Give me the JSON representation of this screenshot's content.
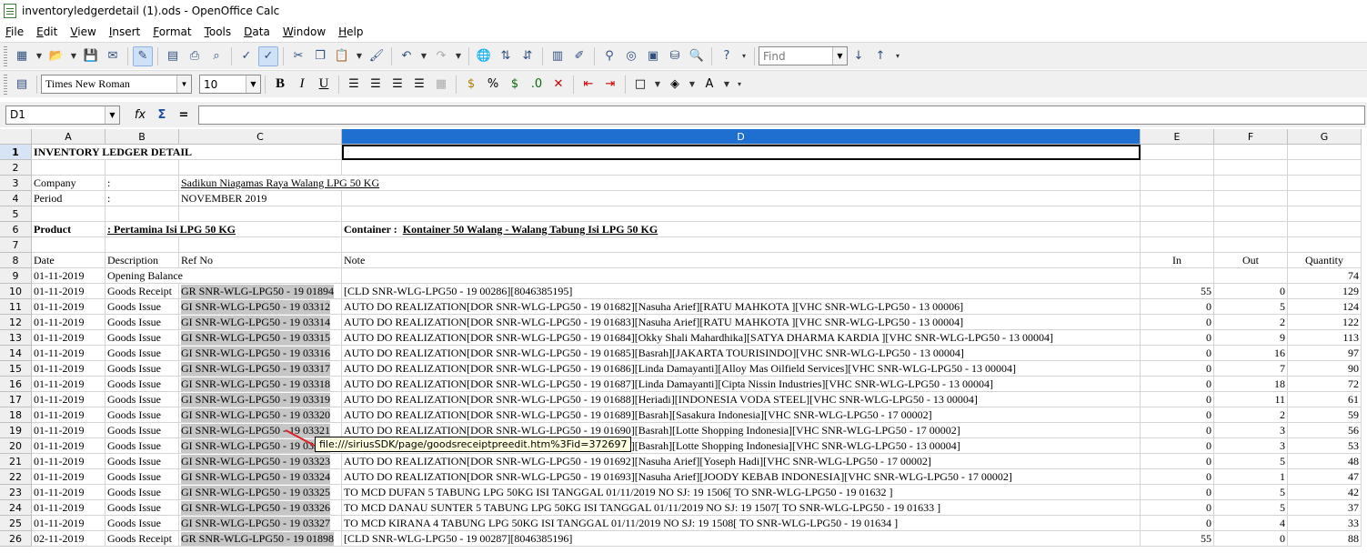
{
  "window": {
    "title": "inventoryledgerdetail (1).ods - OpenOffice Calc"
  },
  "menu": [
    "File",
    "Edit",
    "View",
    "Insert",
    "Format",
    "Tools",
    "Data",
    "Window",
    "Help"
  ],
  "toolbar": {
    "find_placeholder": "Find"
  },
  "format": {
    "font_name": "Times New Roman",
    "font_size": "10"
  },
  "formula": {
    "cell_ref": "D1",
    "func_icon": "fx",
    "sum_icon": "Σ",
    "equal_icon": "=",
    "content": ""
  },
  "columns": [
    "A",
    "B",
    "C",
    "D",
    "E",
    "F",
    "G"
  ],
  "tooltip": "file:///siriusSDK/page/goodsreceiptpreedit.htm%3Fid=372697",
  "sheet": {
    "title": "INVENTORY LEDGER DETAIL",
    "company_label": "Company",
    "company_colon": ":",
    "company_value": "Sadikun Niagamas Raya Walang LPG 50 KG",
    "period_label": "Period",
    "period_colon": ":",
    "period_value": "NOVEMBER 2019",
    "product_label": "Product",
    "product_value": ":  Pertamina Isi LPG 50 KG",
    "container_label": "Container :  ",
    "container_value": "Kontainer 50 Walang - Walang Tabung Isi LPG 50 KG",
    "headers": {
      "date": "Date",
      "description": "Description",
      "ref": "Ref No",
      "note": "Note",
      "in": "In",
      "out": "Out",
      "qty": "Quantity"
    },
    "opening": {
      "date": "01-11-2019",
      "description": "Opening Balance",
      "qty": "74"
    },
    "rows": [
      {
        "row": "10",
        "date": "01-11-2019",
        "desc": "Goods Receipt",
        "ref": "GR SNR-WLG-LPG50 - 19 01894",
        "note": "[CLD SNR-WLG-LPG50 - 19 00286][8046385195]",
        "in": "55",
        "out": "0",
        "qty": "129"
      },
      {
        "row": "11",
        "date": "01-11-2019",
        "desc": "Goods Issue",
        "ref": "GI SNR-WLG-LPG50 - 19 03312",
        "note": "AUTO DO REALIZATION[DOR SNR-WLG-LPG50 - 19 01682][Nasuha Arief][RATU MAHKOTA ][VHC SNR-WLG-LPG50 - 13 00006]",
        "in": "0",
        "out": "5",
        "qty": "124"
      },
      {
        "row": "12",
        "date": "01-11-2019",
        "desc": "Goods Issue",
        "ref": "GI SNR-WLG-LPG50 - 19 03314",
        "note": "AUTO DO REALIZATION[DOR SNR-WLG-LPG50 - 19 01683][Nasuha Arief][RATU MAHKOTA ][VHC SNR-WLG-LPG50 - 13 00004]",
        "in": "0",
        "out": "2",
        "qty": "122"
      },
      {
        "row": "13",
        "date": "01-11-2019",
        "desc": "Goods Issue",
        "ref": "GI SNR-WLG-LPG50 - 19 03315",
        "note": "AUTO DO REALIZATION[DOR SNR-WLG-LPG50 - 19 01684][Okky Shali Mahardhika][SATYA DHARMA KARDIA ][VHC SNR-WLG-LPG50 - 13 00004]",
        "in": "0",
        "out": "9",
        "qty": "113"
      },
      {
        "row": "14",
        "date": "01-11-2019",
        "desc": "Goods Issue",
        "ref": "GI SNR-WLG-LPG50 - 19 03316",
        "note": "AUTO DO REALIZATION[DOR SNR-WLG-LPG50 - 19 01685][Basrah][JAKARTA TOURISINDO][VHC SNR-WLG-LPG50 - 13 00004]",
        "in": "0",
        "out": "16",
        "qty": "97"
      },
      {
        "row": "15",
        "date": "01-11-2019",
        "desc": "Goods Issue",
        "ref": "GI SNR-WLG-LPG50 - 19 03317",
        "note": "AUTO DO REALIZATION[DOR SNR-WLG-LPG50 - 19 01686][Linda Damayanti][Alloy Mas Oilfield Services][VHC SNR-WLG-LPG50 - 13 00004]",
        "in": "0",
        "out": "7",
        "qty": "90"
      },
      {
        "row": "16",
        "date": "01-11-2019",
        "desc": "Goods Issue",
        "ref": "GI SNR-WLG-LPG50 - 19 03318",
        "note": "AUTO DO REALIZATION[DOR SNR-WLG-LPG50 - 19 01687][Linda Damayanti][Cipta Nissin Industries][VHC SNR-WLG-LPG50 - 13 00004]",
        "in": "0",
        "out": "18",
        "qty": "72"
      },
      {
        "row": "17",
        "date": "01-11-2019",
        "desc": "Goods Issue",
        "ref": "GI SNR-WLG-LPG50 - 19 03319",
        "note": "AUTO DO REALIZATION[DOR SNR-WLG-LPG50 - 19 01688][Heriadi][INDONESIA VODA STEEL][VHC SNR-WLG-LPG50 - 13 00004]",
        "in": "0",
        "out": "11",
        "qty": "61"
      },
      {
        "row": "18",
        "date": "01-11-2019",
        "desc": "Goods Issue",
        "ref": "GI SNR-WLG-LPG50 - 19 03320",
        "note": "AUTO DO REALIZATION[DOR SNR-WLG-LPG50 - 19 01689][Basrah][Sasakura Indonesia][VHC SNR-WLG-LPG50 - 17 00002]",
        "in": "0",
        "out": "2",
        "qty": "59"
      },
      {
        "row": "19",
        "date": "01-11-2019",
        "desc": "Goods Issue",
        "ref": "GI SNR-WLG-LPG50 - 19 03321",
        "note": "AUTO DO REALIZATION[DOR SNR-WLG-LPG50 - 19 01690][Basrah][Lotte Shopping Indonesia][VHC SNR-WLG-LPG50 - 17 00002]",
        "in": "0",
        "out": "3",
        "qty": "56"
      },
      {
        "row": "20",
        "date": "01-11-2019",
        "desc": "Goods Issue",
        "ref": "GI SNR-WLG-LPG50 - 19 03322",
        "note": "AUTO DO REALIZATION[DOR SNR-WLG-LPG50 - 19 01691][Basrah][Lotte Shopping Indonesia][VHC SNR-WLG-LPG50 - 13 00004]",
        "in": "0",
        "out": "3",
        "qty": "53"
      },
      {
        "row": "21",
        "date": "01-11-2019",
        "desc": "Goods Issue",
        "ref": "GI SNR-WLG-LPG50 - 19 03323",
        "note": "AUTO DO REALIZATION[DOR SNR-WLG-LPG50 - 19 01692][Nasuha Arief][Yoseph Hadi][VHC SNR-WLG-LPG50 - 17 00002]",
        "in": "0",
        "out": "5",
        "qty": "48"
      },
      {
        "row": "22",
        "date": "01-11-2019",
        "desc": "Goods Issue",
        "ref": "GI SNR-WLG-LPG50 - 19 03324",
        "note": "AUTO DO REALIZATION[DOR SNR-WLG-LPG50 - 19 01693][Nasuha Arief][JOODY KEBAB INDONESIA][VHC SNR-WLG-LPG50 - 17 00002]",
        "in": "0",
        "out": "1",
        "qty": "47"
      },
      {
        "row": "23",
        "date": "01-11-2019",
        "desc": "Goods Issue",
        "ref": "GI SNR-WLG-LPG50 - 19 03325",
        "note": "TO MCD DUFAN 5 TABUNG LPG 50KG ISI TANGGAL 01/11/2019 NO SJ: 19 1506[ TO SNR-WLG-LPG50 - 19 01632 ]",
        "in": "0",
        "out": "5",
        "qty": "42"
      },
      {
        "row": "24",
        "date": "01-11-2019",
        "desc": "Goods Issue",
        "ref": "GI SNR-WLG-LPG50 - 19 03326",
        "note": "TO MCD DANAU SUNTER 5 TABUNG LPG 50KG ISI TANGGAL 01/11/2019 NO SJ: 19 1507[ TO SNR-WLG-LPG50 - 19 01633 ]",
        "in": "0",
        "out": "5",
        "qty": "37"
      },
      {
        "row": "25",
        "date": "01-11-2019",
        "desc": "Goods Issue",
        "ref": "GI SNR-WLG-LPG50 - 19 03327",
        "note": "TO MCD KIRANA 4 TABUNG LPG 50KG ISI TANGGAL 01/11/2019 NO SJ: 19 1508[ TO SNR-WLG-LPG50 - 19 01634 ]",
        "in": "0",
        "out": "4",
        "qty": "33"
      },
      {
        "row": "26",
        "date": "02-11-2019",
        "desc": "Goods Receipt",
        "ref": "GR SNR-WLG-LPG50 - 19 01898",
        "note": "[CLD SNR-WLG-LPG50 - 19 00287][8046385196]",
        "in": "55",
        "out": "0",
        "qty": "88"
      }
    ]
  }
}
